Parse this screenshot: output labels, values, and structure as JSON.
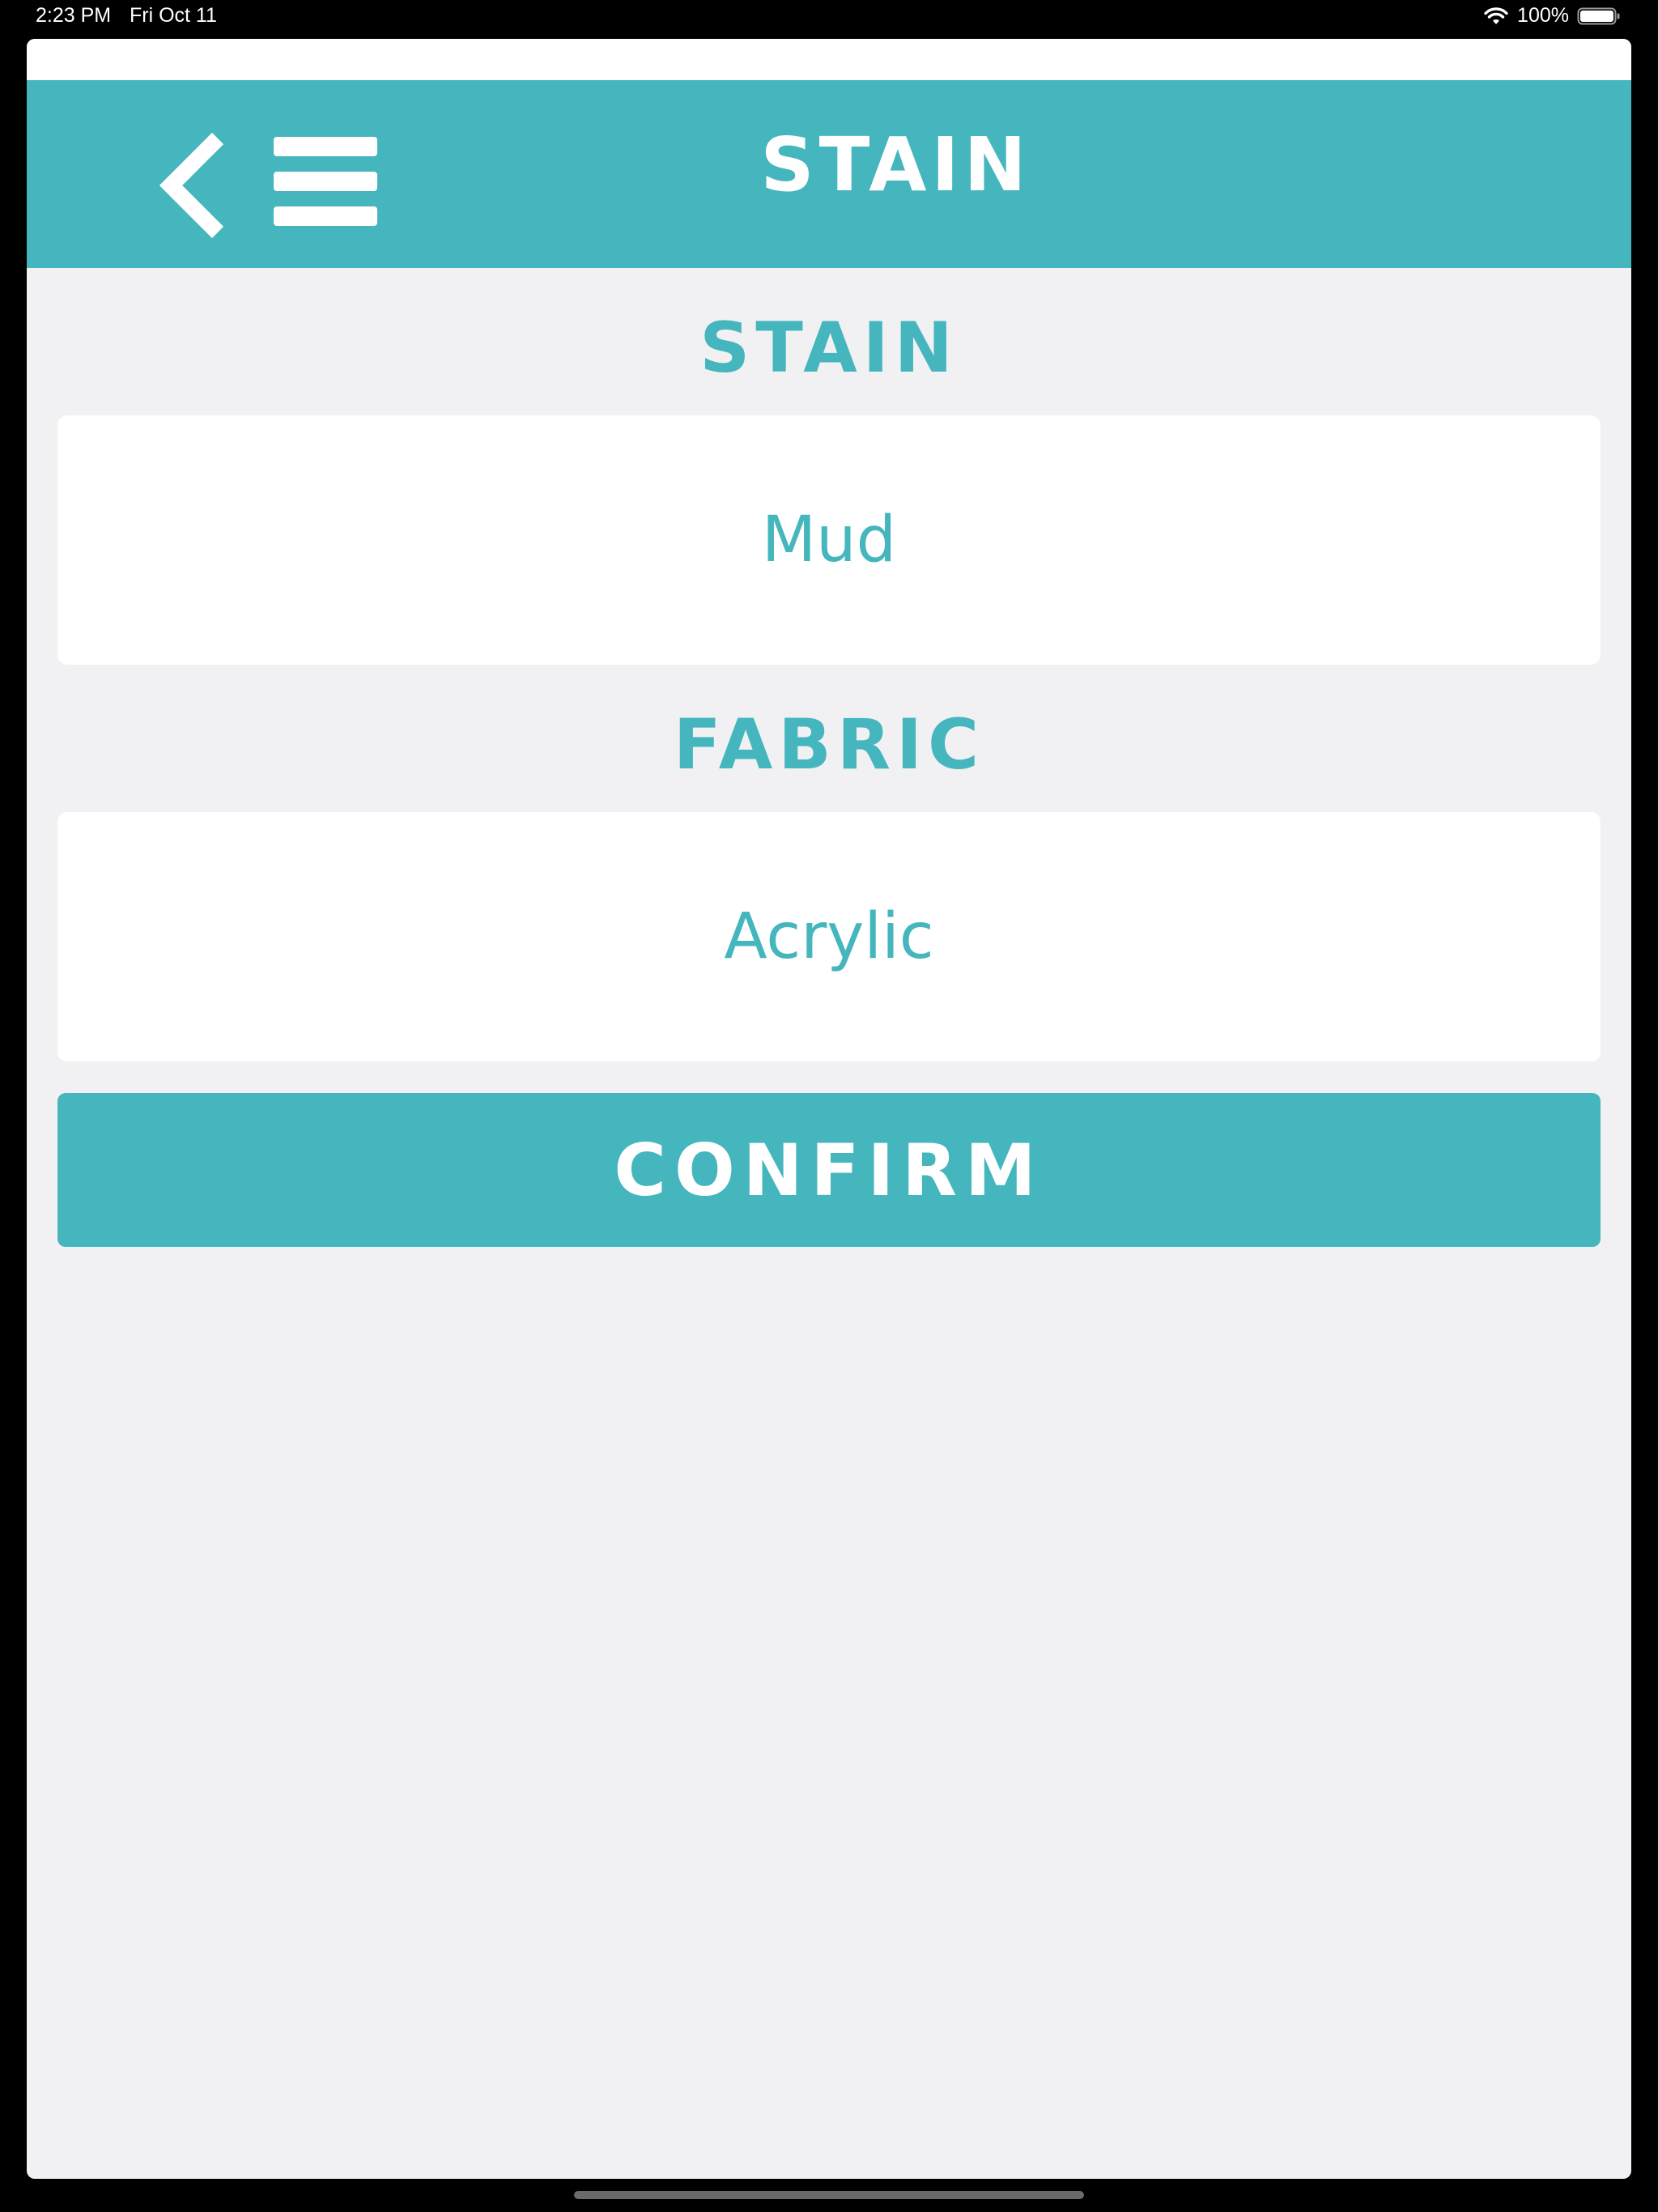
{
  "status_bar": {
    "time": "2:23 PM",
    "date": "Fri Oct 11",
    "battery": "100%",
    "icons": [
      "wifi-icon",
      "battery-icon"
    ]
  },
  "header": {
    "title": "STAIN",
    "icons": [
      "chevron-left-icon",
      "hamburger-menu-icon"
    ]
  },
  "stain": {
    "label": "STAIN",
    "value": "Mud"
  },
  "fabric": {
    "label": "FABRIC",
    "value": "Acrylic"
  },
  "confirm": {
    "label": "CONFIRM"
  },
  "colors": {
    "accent": "#46b6be",
    "background": "#f1f1f3",
    "card": "#ffffff",
    "text_on_accent": "#ffffff"
  }
}
